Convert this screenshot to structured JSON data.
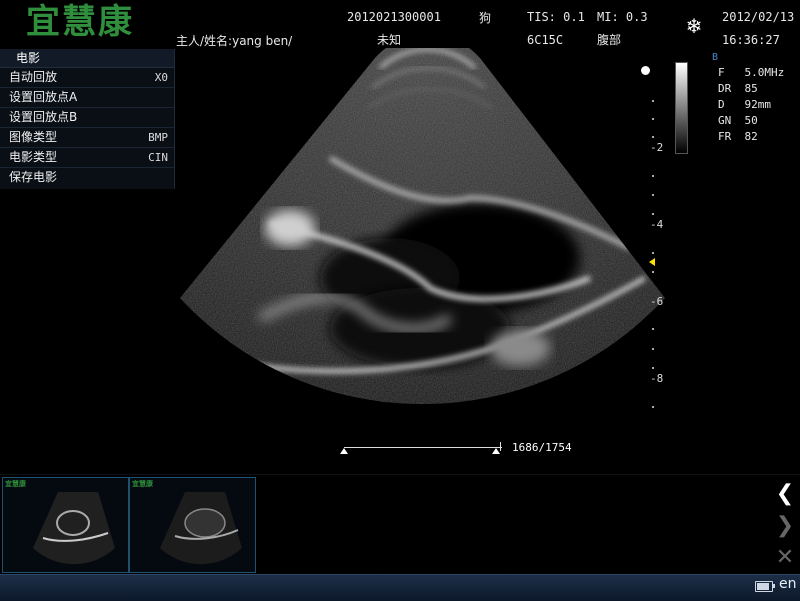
{
  "header": {
    "logo": "宜慧康",
    "patient_label": "主人/姓名:yang ben/",
    "exam_id": "2012021300001",
    "species": "狗",
    "sex": "未知",
    "tis": "TIS: 0.1",
    "mi": "MI: 0.3",
    "probe": "6C15C",
    "exam_type": "腹部",
    "date": "2012/02/13",
    "time": "16:36:27",
    "freeze_icon": "snowflake-icon"
  },
  "cine_menu": {
    "title": "电影",
    "items": [
      {
        "label": "自动回放",
        "value": "X0"
      },
      {
        "label": "设置回放点A",
        "value": ""
      },
      {
        "label": "设置回放点B",
        "value": ""
      },
      {
        "label": "图像类型",
        "value": "BMP"
      },
      {
        "label": "电影类型",
        "value": "CIN"
      },
      {
        "label": "保存电影",
        "value": ""
      }
    ]
  },
  "depth_scale": [
    "-2",
    "-4",
    "-6",
    "-8"
  ],
  "params": {
    "mode": "B",
    "F": "F   5.0MHz",
    "DR": "DR  85",
    "D": "D   92mm",
    "GN": "GN  50",
    "FR": "FR  82"
  },
  "cine": {
    "counter": "1686/1754",
    "position_fraction": 0.961
  },
  "thumbnails": [
    {
      "logo": "宜慧康"
    },
    {
      "logo": "宜慧康"
    }
  ],
  "nav": {
    "prev_icon": "chevron-left-icon",
    "next_icon": "chevron-right-icon",
    "delete_icon": "close-icon"
  },
  "status": {
    "battery_icon": "battery-icon",
    "language": "en"
  },
  "colors": {
    "logo": "#2f8f3c",
    "focus_marker": "#ffe000",
    "mode_label": "#4a86c8"
  }
}
